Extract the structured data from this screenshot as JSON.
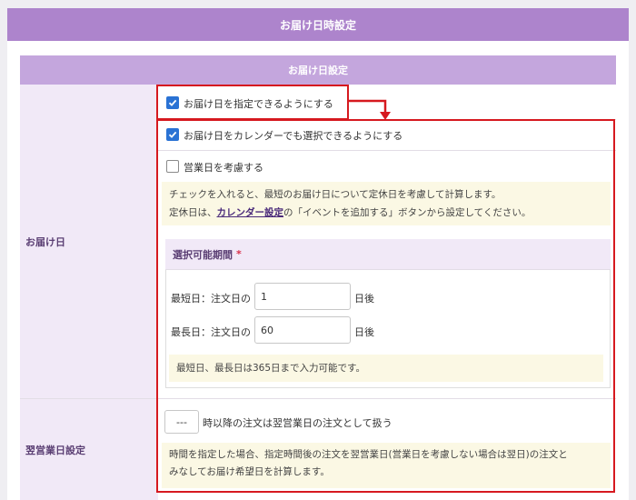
{
  "outer_header": "お届け日時設定",
  "section_header": "お届け日設定",
  "labels": {
    "delivery_date": "お届け日",
    "next_business_day": "翌営業日設定"
  },
  "options": {
    "specify_date": {
      "label": "お届け日を指定できるようにする",
      "checked": true
    },
    "calendar_select": {
      "label": "お届け日をカレンダーでも選択できるようにする",
      "checked": true
    },
    "business_days": {
      "label": "営業日を考慮する",
      "checked": false
    }
  },
  "business_note": {
    "line1": "チェックを入れると、最短のお届け日について定休日を考慮して計算します。",
    "line2_prefix": "定休日は、",
    "line2_link": "カレンダー設定",
    "line2_suffix": "の「イベントを追加する」ボタンから設定してください。"
  },
  "period": {
    "title": "選択可能期間",
    "required_mark": "*",
    "min_label": "最短日：注文日の",
    "min_value": "1",
    "max_label": "最長日：注文日の",
    "max_value": "60",
    "unit": "日後",
    "note": "最短日、最長日は365日まで入力可能です。"
  },
  "next_day": {
    "select_value": "---",
    "suffix": "時以降の注文は翌営業日の注文として扱う",
    "note_line1": "時間を指定した場合、指定時間後の注文を翌営業日(営業日を考慮しない場合は翌日)の注文と",
    "note_line2": "みなしてお届け希望日を計算します。"
  },
  "colors": {
    "header": "#ad84cc",
    "accent_red": "#d6191f",
    "checkbox": "#2a72d4"
  }
}
